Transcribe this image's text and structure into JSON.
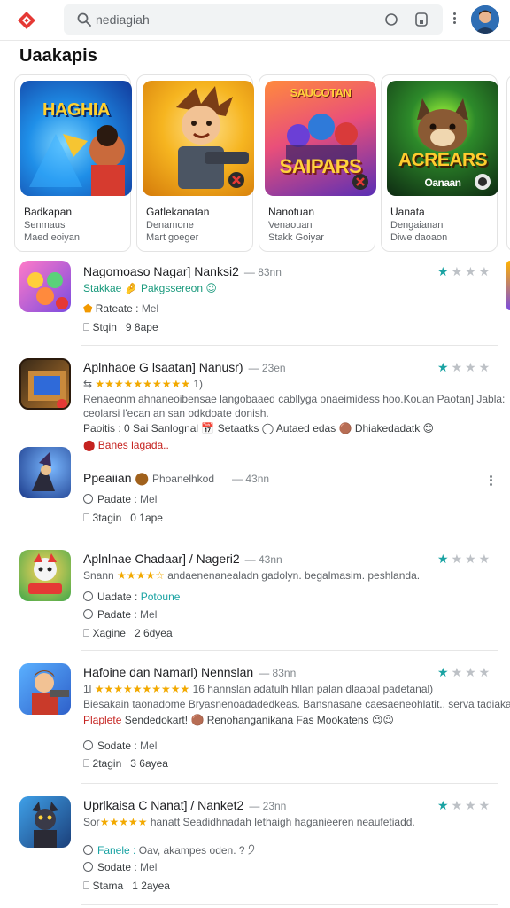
{
  "topbar": {
    "search_placeholder": "nediagiah"
  },
  "section_title": "Uaakapis",
  "featured": [
    {
      "art_title": "HAGHIA",
      "title": "Badkapan",
      "sub": "Senmaus",
      "meta": "Maed eoiyan"
    },
    {
      "art_title": "",
      "title": "Gatlekanatan",
      "sub": "Denamone",
      "meta": "Mart goeger"
    },
    {
      "art_title": "SAIPARS",
      "art_top": "SAUCOTAN",
      "title": "Nanotuan",
      "sub": "Venaouan",
      "meta": "Stakk Goiyar"
    },
    {
      "art_title": "ACREARS",
      "art_bottom": "Oanaan",
      "title": "Uanata",
      "sub": "Dengaianan",
      "meta": "Diwe daoaon"
    }
  ],
  "list": [
    {
      "title": "Nagomoaso Nagar] Nanksi2",
      "time": "— 83nn",
      "line1": "Stakkae 🤌 Pakgssereon 😉",
      "line2_label": "Rateate :",
      "line2_value": "Mel",
      "line3_label": "Stqin",
      "line3_value": "9 8ape",
      "rating": 1
    },
    {
      "title": "Aplnhaoe G lsaatan] Nanusr)",
      "time": "— 23en",
      "line1_stars": "★★★★★★★★★★",
      "line1_tail": "1)",
      "line2": "Renaeonm ahnaneoibensae langobaaed cabllyga onaeimidess hoo.Kouan Paotan] Jabla:",
      "line3": "ceolarsi l'ecan an san odkdoate donish.",
      "line4": "Paoitis : 0 Sai Sanlognal 📅 Setaatks ◯ Autaed edas 🟤 Dhiakedadatk 😊",
      "line5": "Banes lagada..",
      "rating": 1
    },
    {
      "title": "Ppeaiian",
      "title_tail": "Phoanelhkod",
      "time": "— 43nn",
      "line2_label": "Padate :",
      "line2_value": "Mel",
      "line3_label": "3tagin",
      "line3_value": "0 1ape"
    },
    {
      "title": "Aplnlnae Chadaar] / Nageri2",
      "time": "— 43nn",
      "line1_pre": "Snann",
      "line1_stars": "★★★★☆",
      "line1_tail": "andaenenanealadn gadolyn. begalmasim. peshlanda.",
      "line2_label": "Uadate :",
      "line2_value": "Potoune",
      "line3_label": "Padate :",
      "line3_value": "Mel",
      "line4_label": "Xagine",
      "line4_value": "2 6dyea",
      "rating": 1
    },
    {
      "title": "Hafoine dan Namarl) Nennslan",
      "time": "— 83nn",
      "line1_pre": "1l",
      "line1_stars": "★★★★★★★★★★",
      "line1_tail": "16 hannslan adatulh hllan palan dlaapal padetanal)",
      "line2": "Biesakain taonadome Bryasnenoadadedkeas. Bansnasane caesaeneohlatit.. serva tadiaka.",
      "line3_red": "Plaplete",
      "line3": "Sendedokart! 🟤 Renohanganikana Fas Mookatens 😉😉",
      "line4_label": "Sodate :",
      "line4_value": "Mel",
      "line5_label": "2tagin",
      "line5_value": "3 6ayea",
      "rating": 1
    },
    {
      "title": "Uprlkaisa C Nanat] / Nanket2",
      "time": "— 23nn",
      "line1_pre": "Sor",
      "line1_stars": "★★★★★",
      "line1_tail": "hanatt Seadidhnadah lethaigh  haganieeren neaufetiadd.",
      "line2_label": "Fanele :",
      "line2_value": "Oav, akampes oden. ? 🤈",
      "line3_label": "Sodate :",
      "line3_value": "Mel",
      "line4_label": "Stama",
      "line4_value": "1 2ayea",
      "rating": 1
    }
  ]
}
